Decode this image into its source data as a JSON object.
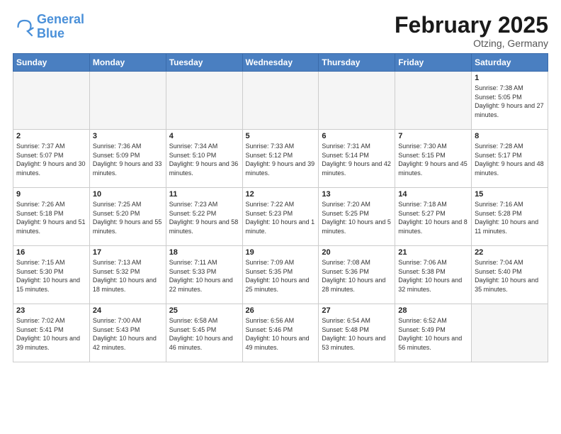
{
  "header": {
    "logo_line1": "General",
    "logo_line2": "Blue",
    "title": "February 2025",
    "subtitle": "Otzing, Germany"
  },
  "weekdays": [
    "Sunday",
    "Monday",
    "Tuesday",
    "Wednesday",
    "Thursday",
    "Friday",
    "Saturday"
  ],
  "weeks": [
    [
      {
        "day": "",
        "info": ""
      },
      {
        "day": "",
        "info": ""
      },
      {
        "day": "",
        "info": ""
      },
      {
        "day": "",
        "info": ""
      },
      {
        "day": "",
        "info": ""
      },
      {
        "day": "",
        "info": ""
      },
      {
        "day": "1",
        "info": "Sunrise: 7:38 AM\nSunset: 5:05 PM\nDaylight: 9 hours and 27 minutes."
      }
    ],
    [
      {
        "day": "2",
        "info": "Sunrise: 7:37 AM\nSunset: 5:07 PM\nDaylight: 9 hours and 30 minutes."
      },
      {
        "day": "3",
        "info": "Sunrise: 7:36 AM\nSunset: 5:09 PM\nDaylight: 9 hours and 33 minutes."
      },
      {
        "day": "4",
        "info": "Sunrise: 7:34 AM\nSunset: 5:10 PM\nDaylight: 9 hours and 36 minutes."
      },
      {
        "day": "5",
        "info": "Sunrise: 7:33 AM\nSunset: 5:12 PM\nDaylight: 9 hours and 39 minutes."
      },
      {
        "day": "6",
        "info": "Sunrise: 7:31 AM\nSunset: 5:14 PM\nDaylight: 9 hours and 42 minutes."
      },
      {
        "day": "7",
        "info": "Sunrise: 7:30 AM\nSunset: 5:15 PM\nDaylight: 9 hours and 45 minutes."
      },
      {
        "day": "8",
        "info": "Sunrise: 7:28 AM\nSunset: 5:17 PM\nDaylight: 9 hours and 48 minutes."
      }
    ],
    [
      {
        "day": "9",
        "info": "Sunrise: 7:26 AM\nSunset: 5:18 PM\nDaylight: 9 hours and 51 minutes."
      },
      {
        "day": "10",
        "info": "Sunrise: 7:25 AM\nSunset: 5:20 PM\nDaylight: 9 hours and 55 minutes."
      },
      {
        "day": "11",
        "info": "Sunrise: 7:23 AM\nSunset: 5:22 PM\nDaylight: 9 hours and 58 minutes."
      },
      {
        "day": "12",
        "info": "Sunrise: 7:22 AM\nSunset: 5:23 PM\nDaylight: 10 hours and 1 minute."
      },
      {
        "day": "13",
        "info": "Sunrise: 7:20 AM\nSunset: 5:25 PM\nDaylight: 10 hours and 5 minutes."
      },
      {
        "day": "14",
        "info": "Sunrise: 7:18 AM\nSunset: 5:27 PM\nDaylight: 10 hours and 8 minutes."
      },
      {
        "day": "15",
        "info": "Sunrise: 7:16 AM\nSunset: 5:28 PM\nDaylight: 10 hours and 11 minutes."
      }
    ],
    [
      {
        "day": "16",
        "info": "Sunrise: 7:15 AM\nSunset: 5:30 PM\nDaylight: 10 hours and 15 minutes."
      },
      {
        "day": "17",
        "info": "Sunrise: 7:13 AM\nSunset: 5:32 PM\nDaylight: 10 hours and 18 minutes."
      },
      {
        "day": "18",
        "info": "Sunrise: 7:11 AM\nSunset: 5:33 PM\nDaylight: 10 hours and 22 minutes."
      },
      {
        "day": "19",
        "info": "Sunrise: 7:09 AM\nSunset: 5:35 PM\nDaylight: 10 hours and 25 minutes."
      },
      {
        "day": "20",
        "info": "Sunrise: 7:08 AM\nSunset: 5:36 PM\nDaylight: 10 hours and 28 minutes."
      },
      {
        "day": "21",
        "info": "Sunrise: 7:06 AM\nSunset: 5:38 PM\nDaylight: 10 hours and 32 minutes."
      },
      {
        "day": "22",
        "info": "Sunrise: 7:04 AM\nSunset: 5:40 PM\nDaylight: 10 hours and 35 minutes."
      }
    ],
    [
      {
        "day": "23",
        "info": "Sunrise: 7:02 AM\nSunset: 5:41 PM\nDaylight: 10 hours and 39 minutes."
      },
      {
        "day": "24",
        "info": "Sunrise: 7:00 AM\nSunset: 5:43 PM\nDaylight: 10 hours and 42 minutes."
      },
      {
        "day": "25",
        "info": "Sunrise: 6:58 AM\nSunset: 5:45 PM\nDaylight: 10 hours and 46 minutes."
      },
      {
        "day": "26",
        "info": "Sunrise: 6:56 AM\nSunset: 5:46 PM\nDaylight: 10 hours and 49 minutes."
      },
      {
        "day": "27",
        "info": "Sunrise: 6:54 AM\nSunset: 5:48 PM\nDaylight: 10 hours and 53 minutes."
      },
      {
        "day": "28",
        "info": "Sunrise: 6:52 AM\nSunset: 5:49 PM\nDaylight: 10 hours and 56 minutes."
      },
      {
        "day": "",
        "info": ""
      }
    ]
  ]
}
